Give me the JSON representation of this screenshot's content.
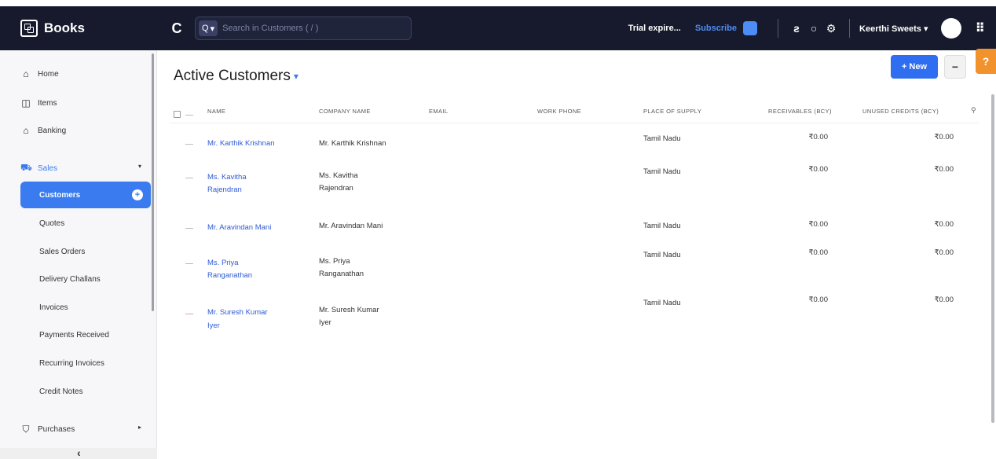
{
  "app": {
    "name": "Books"
  },
  "header": {
    "search_scope": "Q",
    "search_placeholder": "Search in Customers ( / )",
    "trial_text": "Trial expire...",
    "subscribe_label": "Subscribe",
    "org_name": "Keerthi Sweets"
  },
  "sidebar": {
    "items": [
      {
        "label": "Home"
      },
      {
        "label": "Items"
      },
      {
        "label": "Banking"
      },
      {
        "label": "Sales"
      },
      {
        "label": "Purchases"
      }
    ],
    "sales_sub": [
      {
        "label": "Customers"
      },
      {
        "label": "Quotes"
      },
      {
        "label": "Sales Orders"
      },
      {
        "label": "Delivery Challans"
      },
      {
        "label": "Invoices"
      },
      {
        "label": "Payments Received"
      },
      {
        "label": "Recurring Invoices"
      },
      {
        "label": "Credit Notes"
      }
    ]
  },
  "main": {
    "title": "Active Customers",
    "new_label": "+ New",
    "columns": [
      "NAME",
      "COMPANY NAME",
      "EMAIL",
      "WORK PHONE",
      "PLACE OF SUPPLY",
      "RECEIVABLES (BCY)",
      "UNUSED CREDITS (BCY)"
    ],
    "rows": [
      {
        "name": [
          "Mr. Karthik Krishnan"
        ],
        "company": [
          "Mr. Karthik Krishnan"
        ],
        "place": "Tamil Nadu",
        "receivables": "₹0.00",
        "credits": "₹0.00"
      },
      {
        "name": [
          "Ms. Kavitha",
          "Rajendran"
        ],
        "company": [
          "Ms. Kavitha",
          "Rajendran"
        ],
        "place": "Tamil Nadu",
        "receivables": "₹0.00",
        "credits": "₹0.00"
      },
      {
        "name": [
          "Mr. Aravindan Mani"
        ],
        "company": [
          "Mr. Aravindan Mani"
        ],
        "place": "Tamil Nadu",
        "receivables": "₹0.00",
        "credits": "₹0.00"
      },
      {
        "name": [
          "Ms. Priya",
          "Ranganathan"
        ],
        "company": [
          "Ms. Priya",
          "Ranganathan"
        ],
        "place": "Tamil Nadu",
        "receivables": "₹0.00",
        "credits": "₹0.00"
      },
      {
        "name": [
          "Mr. Suresh Kumar",
          "Iyer"
        ],
        "company": [
          "Mr. Suresh Kumar",
          "Iyer"
        ],
        "place": "Tamil Nadu",
        "receivables": "₹0.00",
        "credits": "₹0.00"
      }
    ]
  }
}
